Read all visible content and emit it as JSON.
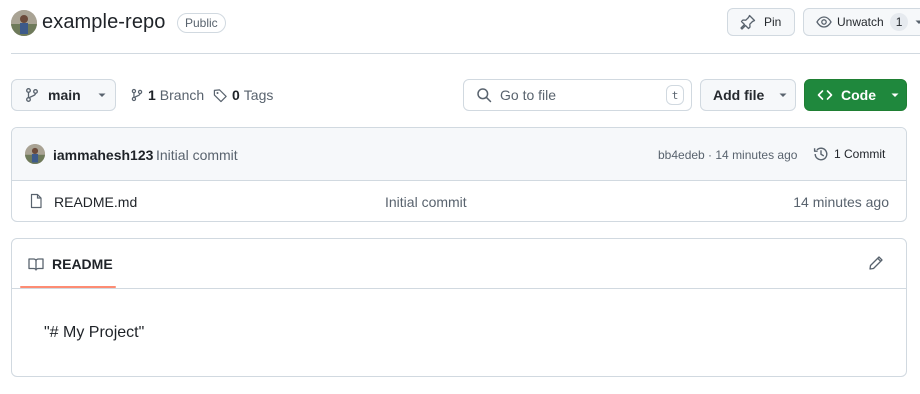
{
  "repo": {
    "name": "example-repo",
    "visibility": "Public"
  },
  "actions": {
    "pin_label": "Pin",
    "watch_label": "Unwatch",
    "watch_count": "1"
  },
  "toolbar": {
    "branch": "main",
    "branches_count": "1",
    "branches_label": "Branch",
    "tags_count": "0",
    "tags_label": "Tags",
    "search_placeholder": "Go to file",
    "search_shortcut": "t",
    "add_file_label": "Add file",
    "code_label": "Code"
  },
  "latest_commit": {
    "author": "iammahesh123",
    "message": "Initial commit",
    "sha_time": "bb4edeb · 14 minutes ago",
    "commits_count_label": "1 Commit"
  },
  "files": [
    {
      "name": "README.md",
      "message": "Initial commit",
      "time": "14 minutes ago"
    }
  ],
  "readme": {
    "tab_label": "README",
    "content": "\"# My Project\""
  },
  "colors": {
    "accent_green": "#1f883d",
    "tab_underline": "#fd8c73",
    "border": "#d1d9e0"
  }
}
